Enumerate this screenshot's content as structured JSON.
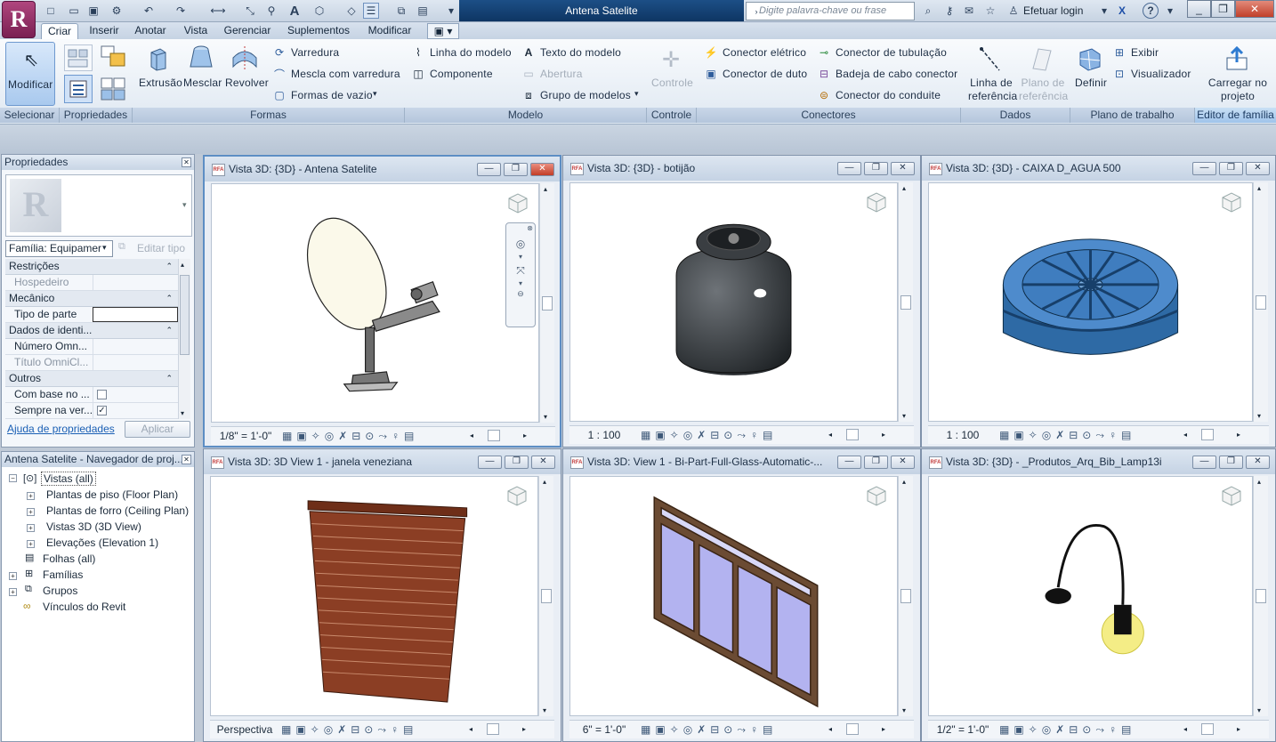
{
  "app": {
    "title": "Antena Satelite",
    "search_placeholder": "Digite palavra-chave ou frase",
    "login_label": "Efetuar login",
    "help_symbol": "?",
    "logo_letter": "R",
    "brand_color": "#8b2a5e"
  },
  "tabs": [
    "Criar",
    "Inserir",
    "Anotar",
    "Vista",
    "Gerenciar",
    "Suplementos",
    "Modificar"
  ],
  "ribbon": {
    "select": {
      "modify_label": "Modificar",
      "panel": "Selecionar"
    },
    "properties_panel": "Propriedades",
    "forms": {
      "extrusion": "Extrusão",
      "blend": "Mesclar",
      "revolve": "Revolver",
      "sweep": "Varredura",
      "swept_blend": "Mescla com varredura",
      "void_forms": "Formas de vazio",
      "panel": "Formas"
    },
    "model": {
      "model_line": "Linha do modelo",
      "component": "Componente",
      "model_text": "Texto do modelo",
      "opening": "Abertura",
      "model_group": "Grupo de modelos",
      "panel": "Modelo"
    },
    "control": {
      "label": "Controle",
      "panel": "Controle"
    },
    "connectors": {
      "electrical": "Conector elétrico",
      "duct": "Conector de duto",
      "pipe": "Conector de tubulação",
      "cable_tray": "Badeja de cabo conector",
      "conduit": "Conector do conduite",
      "panel": "Conectores"
    },
    "datum": {
      "ref_line": "Linha de referência",
      "ref_plane": "Plano de referência",
      "panel": "Dados"
    },
    "work_plane": {
      "set": "Definir",
      "show": "Exibir",
      "viewer": "Visualizador",
      "panel": "Plano de trabalho"
    },
    "family_editor": {
      "load": "Carregar no projeto",
      "panel": "Editor de família"
    }
  },
  "properties": {
    "title": "Propriedades",
    "family_value": "Família: Equipamer",
    "edit_type": "Editar tipo",
    "groups": [
      {
        "name": "Restrições",
        "rows": [
          {
            "key": "Hospedeiro",
            "dim": true
          }
        ]
      },
      {
        "name": "Mecânico",
        "rows": [
          {
            "key": "Tipo de parte",
            "dim": false
          }
        ]
      },
      {
        "name": "Dados de identi...",
        "rows": [
          {
            "key": "Número Omn...",
            "dim": false
          },
          {
            "key": "Título OmniCl...",
            "dim": true
          }
        ]
      },
      {
        "name": "Outros",
        "rows": [
          {
            "key": "Com base no ...",
            "dim": false,
            "check": false
          },
          {
            "key": "Sempre na ver...",
            "dim": false,
            "check": true
          }
        ]
      }
    ],
    "help_link": "Ajuda de propriedades",
    "apply": "Aplicar"
  },
  "browser": {
    "title": "Antena Satelite - Navegador de proj...",
    "items": [
      {
        "label": "Vistas (all)",
        "level": 0,
        "expand": "-"
      },
      {
        "label": "Plantas de piso (Floor Plan)",
        "level": 1,
        "expand": "+"
      },
      {
        "label": "Plantas de forro (Ceiling Plan)",
        "level": 1,
        "expand": "+"
      },
      {
        "label": "Vistas 3D (3D View)",
        "level": 1,
        "expand": "+"
      },
      {
        "label": "Elevações (Elevation 1)",
        "level": 1,
        "expand": "+"
      },
      {
        "label": "Folhas (all)",
        "level": 0,
        "expand": ""
      },
      {
        "label": "Famílias",
        "level": 0,
        "expand": "+"
      },
      {
        "label": "Grupos",
        "level": 0,
        "expand": "+"
      },
      {
        "label": "Vínculos do Revit",
        "level": 0,
        "expand": ""
      }
    ]
  },
  "views": [
    {
      "title": "Vista 3D: {3D} - Antena Satelite",
      "scale": "1/8\" = 1'-0\"",
      "active": true
    },
    {
      "title": "Vista 3D: {3D} - botijão",
      "scale": "1 : 100",
      "active": false
    },
    {
      "title": "Vista 3D: {3D} - CAIXA D_AGUA 500",
      "scale": "1 : 100",
      "active": false
    },
    {
      "title": "Vista 3D: 3D View 1 - janela veneziana",
      "scale": "Perspectiva",
      "active": false
    },
    {
      "title": "Vista 3D: View 1 - Bi-Part-Full-Glass-Automatic-...",
      "scale": "6\" = 1'-0\"",
      "active": false
    },
    {
      "title": "Vista 3D: {3D} - _Produtos_Arq_Bib_Lamp13i",
      "scale": "1/2\" = 1'-0\"",
      "active": false
    }
  ]
}
